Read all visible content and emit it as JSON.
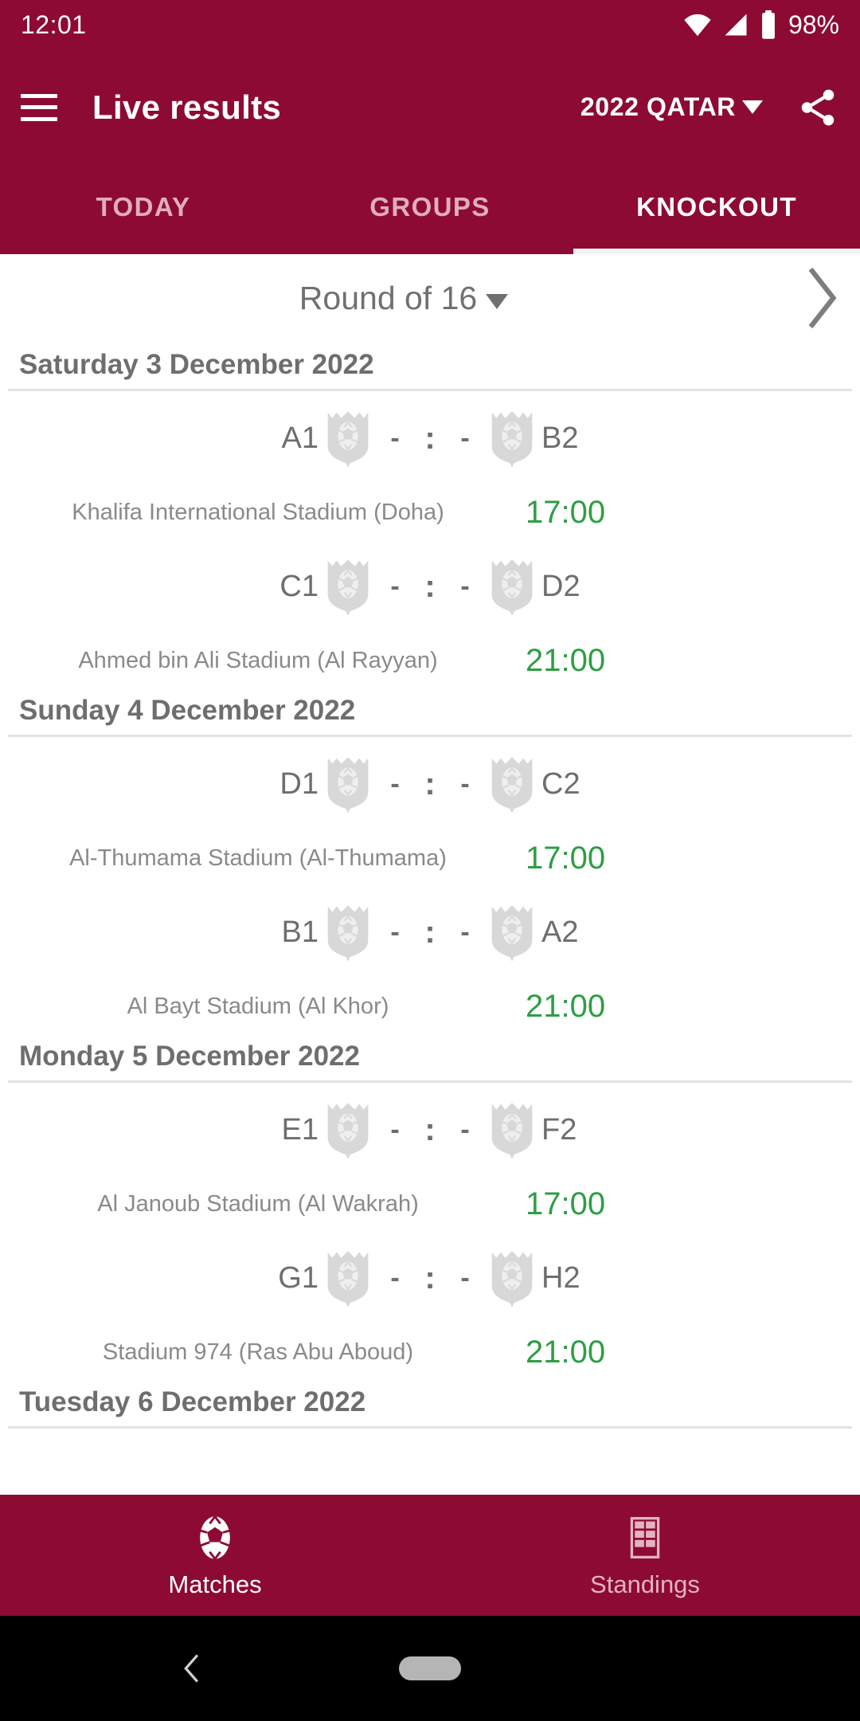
{
  "status_bar": {
    "time": "12:01",
    "battery_pct": "98%",
    "wifi_icon": "wifi-icon",
    "signal_icon": "signal-icon",
    "battery_icon": "battery-icon"
  },
  "app_bar": {
    "menu_icon": "hamburger-menu-icon",
    "title": "Live results",
    "season": "2022 QATAR",
    "season_caret": "chevron-down-icon",
    "share_icon": "share-icon"
  },
  "tabs": [
    {
      "label": "TODAY",
      "active": false
    },
    {
      "label": "GROUPS",
      "active": false
    },
    {
      "label": "KNOCKOUT",
      "active": true
    }
  ],
  "round_selector": {
    "label": "Round of 16",
    "caret": "chevron-down-icon",
    "next_icon": "chevron-right-icon"
  },
  "days": [
    {
      "date": "Saturday 3 December 2022",
      "matches": [
        {
          "home": "A1",
          "away": "B2",
          "home_score": "-",
          "separator": ":",
          "away_score": "-",
          "venue": "Khalifa International Stadium (Doha)",
          "kickoff": "17:00"
        },
        {
          "home": "C1",
          "away": "D2",
          "home_score": "-",
          "separator": ":",
          "away_score": "-",
          "venue": "Ahmed bin Ali Stadium (Al Rayyan)",
          "kickoff": "21:00"
        }
      ]
    },
    {
      "date": "Sunday 4 December 2022",
      "matches": [
        {
          "home": "D1",
          "away": "C2",
          "home_score": "-",
          "separator": ":",
          "away_score": "-",
          "venue": "Al-Thumama Stadium (Al-Thumama)",
          "kickoff": "17:00"
        },
        {
          "home": "B1",
          "away": "A2",
          "home_score": "-",
          "separator": ":",
          "away_score": "-",
          "venue": "Al Bayt Stadium (Al Khor)",
          "kickoff": "21:00"
        }
      ]
    },
    {
      "date": "Monday 5 December 2022",
      "matches": [
        {
          "home": "E1",
          "away": "F2",
          "home_score": "-",
          "separator": ":",
          "away_score": "-",
          "venue": "Al Janoub Stadium (Al Wakrah)",
          "kickoff": "17:00"
        },
        {
          "home": "G1",
          "away": "H2",
          "home_score": "-",
          "separator": ":",
          "away_score": "-",
          "venue": "Stadium 974 (Ras Abu Aboud)",
          "kickoff": "21:00"
        }
      ]
    },
    {
      "date": "Tuesday 6 December 2022",
      "matches": []
    }
  ],
  "bottom_nav": [
    {
      "label": "Matches",
      "icon": "soccer-ball-icon",
      "active": true
    },
    {
      "label": "Standings",
      "icon": "table-grid-icon",
      "active": false
    }
  ],
  "android_nav": {
    "back_icon": "back-chevron-icon",
    "home_icon": "home-pill-icon"
  },
  "colors": {
    "brand": "#8d0b33",
    "accent_time": "#2e9e43",
    "tab_inactive": "#e0adbc",
    "crest_gray": "#d8d8d8",
    "text_gray": "#6e6e6e"
  }
}
